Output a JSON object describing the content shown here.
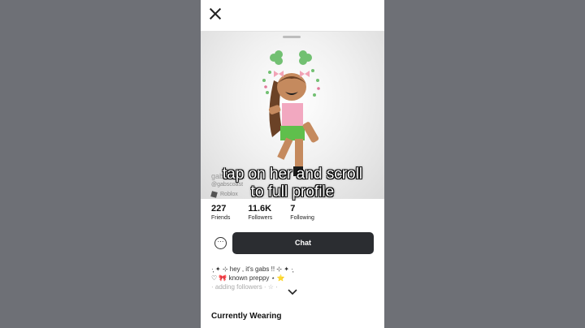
{
  "overlay": {
    "line1": "tap on her and scroll",
    "line2": "to full profile"
  },
  "profile": {
    "display_name": "gabscoast",
    "username": "@gabscoast",
    "roblox_label": "Roblox"
  },
  "stats": [
    {
      "value": "227",
      "label": "Friends"
    },
    {
      "value": "11.6K",
      "label": "Followers"
    },
    {
      "value": "7",
      "label": "Following"
    }
  ],
  "actions": {
    "more_icon": "⋯",
    "chat_label": "Chat"
  },
  "bio": {
    "line1": "·̩͙ ✦ ⊹ hey , it's gabs !! ⊹ ✦ ·̩͙",
    "line2": "♡ 🎀 known preppy ⋆ ⭐",
    "line3": "· adding followers · ☆ ·"
  },
  "sections": {
    "currently_wearing": "Currently Wearing"
  },
  "colors": {
    "accent": "#2b2d31",
    "background": "#6e7076"
  }
}
